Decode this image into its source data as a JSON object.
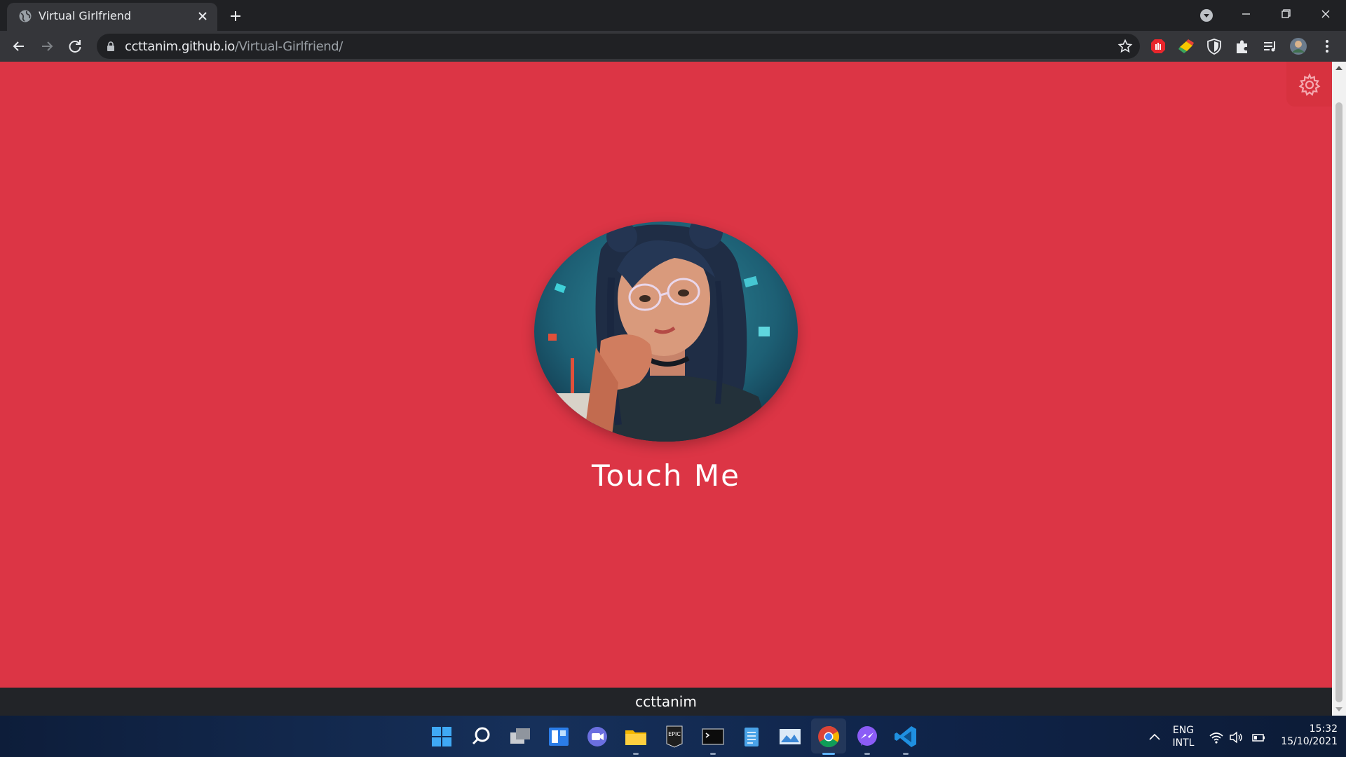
{
  "browser": {
    "tab_title": "Virtual Girlfriend",
    "url_host": "ccttanim.github.io",
    "url_path": "/Virtual-Girlfriend/"
  },
  "page": {
    "background_color": "#dc3545",
    "touch_label": "Touch Me",
    "footer_text": "ccttanim",
    "avatar_description": "illustrated girl with glasses resting chin on hand"
  },
  "taskbar": {
    "apps": [
      "start",
      "search",
      "task-view",
      "widgets",
      "chat",
      "file-explorer",
      "epic-games",
      "terminal",
      "notepad",
      "photos",
      "chrome",
      "messenger",
      "vscode"
    ],
    "tray": {
      "lang_line1": "ENG",
      "lang_line2": "INTL",
      "time": "15:32",
      "date": "15/10/2021"
    }
  }
}
